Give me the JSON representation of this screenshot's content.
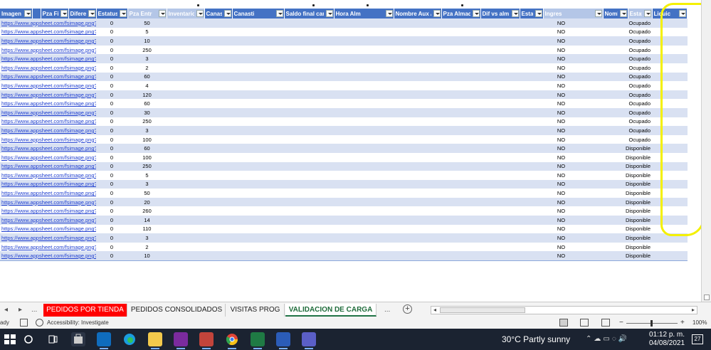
{
  "columns": [
    "Imagen",
    "Pza Fis",
    "Diferer",
    "Estatus",
    "Pza Entr",
    "Inventario",
    "Canastilla",
    "Canasti",
    "Saldo final cana",
    "Hora Alm",
    "Nombre Aux Alm",
    "Pza Almacen",
    "Dif vs alm",
    "Estatus vali",
    "Ingres",
    "Nombre Rep Real",
    "Estatu",
    "Liquic"
  ],
  "link_text": "https://www.appsheet.com/fsimage.png?tableprovider=m",
  "rows": [
    {
      "pza_entr": "0",
      "inventario": "50",
      "ingres": "NO",
      "estatus": "Ocupado"
    },
    {
      "pza_entr": "0",
      "inventario": "5",
      "ingres": "NO",
      "estatus": "Ocupado"
    },
    {
      "pza_entr": "0",
      "inventario": "10",
      "ingres": "NO",
      "estatus": "Ocupado"
    },
    {
      "pza_entr": "0",
      "inventario": "250",
      "ingres": "NO",
      "estatus": "Ocupado"
    },
    {
      "pza_entr": "0",
      "inventario": "3",
      "ingres": "NO",
      "estatus": "Ocupado"
    },
    {
      "pza_entr": "0",
      "inventario": "2",
      "ingres": "NO",
      "estatus": "Ocupado"
    },
    {
      "pza_entr": "0",
      "inventario": "60",
      "ingres": "NO",
      "estatus": "Ocupado"
    },
    {
      "pza_entr": "0",
      "inventario": "4",
      "ingres": "NO",
      "estatus": "Ocupado"
    },
    {
      "pza_entr": "0",
      "inventario": "120",
      "ingres": "NO",
      "estatus": "Ocupado"
    },
    {
      "pza_entr": "0",
      "inventario": "60",
      "ingres": "NO",
      "estatus": "Ocupado"
    },
    {
      "pza_entr": "0",
      "inventario": "30",
      "ingres": "NO",
      "estatus": "Ocupado"
    },
    {
      "pza_entr": "0",
      "inventario": "250",
      "ingres": "NO",
      "estatus": "Ocupado"
    },
    {
      "pza_entr": "0",
      "inventario": "3",
      "ingres": "NO",
      "estatus": "Ocupado"
    },
    {
      "pza_entr": "0",
      "inventario": "100",
      "ingres": "NO",
      "estatus": "Ocupado"
    },
    {
      "pza_entr": "0",
      "inventario": "60",
      "ingres": "NO",
      "estatus": "Disponible"
    },
    {
      "pza_entr": "0",
      "inventario": "100",
      "ingres": "NO",
      "estatus": "Disponible"
    },
    {
      "pza_entr": "0",
      "inventario": "250",
      "ingres": "NO",
      "estatus": "Disponible"
    },
    {
      "pza_entr": "0",
      "inventario": "5",
      "ingres": "NO",
      "estatus": "Disponible"
    },
    {
      "pza_entr": "0",
      "inventario": "3",
      "ingres": "NO",
      "estatus": "Disponible"
    },
    {
      "pza_entr": "0",
      "inventario": "50",
      "ingres": "NO",
      "estatus": "Disponible"
    },
    {
      "pza_entr": "0",
      "inventario": "20",
      "ingres": "NO",
      "estatus": "Disponible"
    },
    {
      "pza_entr": "0",
      "inventario": "260",
      "ingres": "NO",
      "estatus": "Disponible"
    },
    {
      "pza_entr": "0",
      "inventario": "14",
      "ingres": "NO",
      "estatus": "Disponible"
    },
    {
      "pza_entr": "0",
      "inventario": "110",
      "ingres": "NO",
      "estatus": "Disponible"
    },
    {
      "pza_entr": "0",
      "inventario": "3",
      "ingres": "NO",
      "estatus": "Disponible"
    },
    {
      "pza_entr": "0",
      "inventario": "2",
      "ingres": "NO",
      "estatus": "Disponible"
    },
    {
      "pza_entr": "0",
      "inventario": "10",
      "ingres": "NO",
      "estatus": "Disponible"
    }
  ],
  "sheet_tabs": {
    "ellipsis_left": "...",
    "pedidos_tienda": "PEDIDOS POR TIENDA",
    "pedidos_consolidados": "PEDIDOS CONSOLIDADOS",
    "visitas_prog": "VISITAS PROG",
    "validacion_carga": "VALIDACION DE CARGA",
    "ellipsis_right": "...",
    "add": "+"
  },
  "status_bar": {
    "ready": "ady",
    "accessibility": "Accessibility: Investigate",
    "zoom_minus": "−",
    "zoom_plus": "+",
    "zoom_pct": "100%"
  },
  "taskbar": {
    "weather": "30°C  Partly sunny",
    "time": "01:12 p. m.",
    "date": "04/08/2021",
    "notifications": "27"
  },
  "colors": {
    "header_bg": "#4472c4",
    "band_row": "#d9e1f2",
    "link": "#1f3fd0",
    "active_tab": "#217346",
    "red_tab": "#ff0000",
    "highlight": "#f4f000"
  }
}
